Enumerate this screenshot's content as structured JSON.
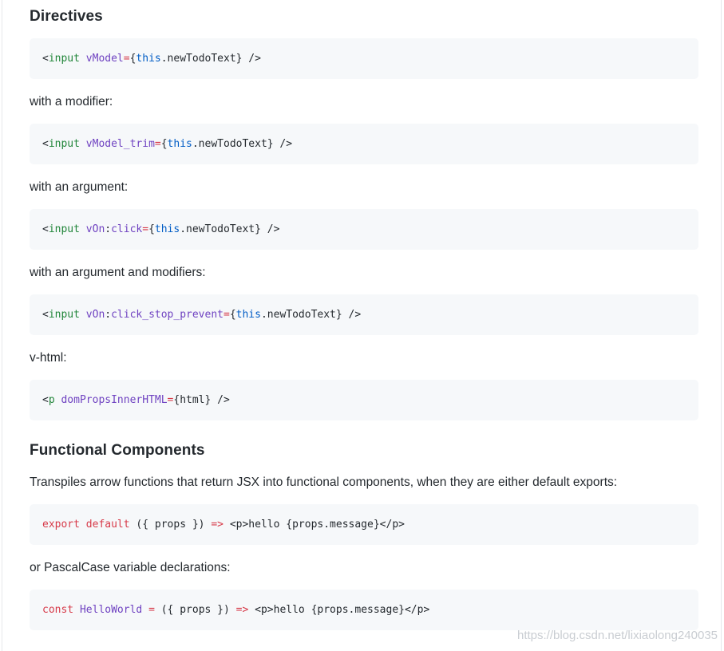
{
  "sections": {
    "directives": {
      "heading": "Directives",
      "code1": {
        "lt": "<",
        "tag": "input",
        "attr": "vModel",
        "eq": "=",
        "lbrace": "{",
        "this": "this",
        "rest": ".newTodoText} />"
      },
      "modifier_text": "with a modifier:",
      "code2": {
        "lt": "<",
        "tag": "input",
        "attr": "vModel_trim",
        "eq": "=",
        "lbrace": "{",
        "this": "this",
        "rest": ".newTodoText} />"
      },
      "argument_text": "with an argument:",
      "code3": {
        "lt": "<",
        "tag": "input",
        "attr_prefix": "vOn",
        "colon": ":",
        "attr_suffix": "click",
        "eq": "=",
        "lbrace": "{",
        "this": "this",
        "rest": ".newTodoText} />"
      },
      "argument_modifiers_text": "with an argument and modifiers:",
      "code4": {
        "lt": "<",
        "tag": "input",
        "attr_prefix": "vOn",
        "colon": ":",
        "attr_suffix": "click_stop_prevent",
        "eq": "=",
        "lbrace": "{",
        "this": "this",
        "rest": ".newTodoText} />"
      },
      "vhtml_text": "v-html:",
      "code5": {
        "lt": "<",
        "tag": "p",
        "attr": "domPropsInnerHTML",
        "eq": "=",
        "rest": "{html} />"
      }
    },
    "functional": {
      "heading": "Functional Components",
      "intro_text": "Transpiles arrow functions that return JSX into functional components, when they are either default exports:",
      "code1": {
        "kw1": "export",
        "kw2": "default",
        "args": " ({ props }) ",
        "arrow": "=>",
        "body": " <p>hello {props.message}</p>"
      },
      "pascal_text": "or PascalCase variable declarations:",
      "code2": {
        "kw": "const",
        "name": "HelloWorld",
        "eq": "=",
        "args": " ({ props }) ",
        "arrow": "=>",
        "body": " <p>hello {props.message}</p>"
      }
    }
  },
  "watermark": "https://blog.csdn.net/lixiaolong240035",
  "colors": {
    "code_bg": "#f6f8fa",
    "tag": "#22863a",
    "attr": "#6f42c1",
    "operator": "#d73a49",
    "keyword_this": "#005cc5",
    "text": "#24292e"
  }
}
